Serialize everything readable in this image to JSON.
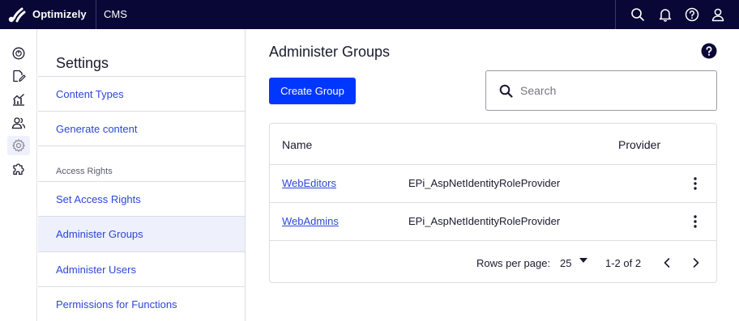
{
  "topbar": {
    "brand": "Optimizely",
    "product": "CMS",
    "icons": [
      "search-icon",
      "bell-icon",
      "help-icon",
      "user-icon"
    ],
    "background": "#080736"
  },
  "rail": {
    "items": [
      "dashboard-icon",
      "edit-icon",
      "analytics-icon",
      "users-icon",
      "gear-icon",
      "puzzle-icon"
    ],
    "active": "gear-icon"
  },
  "settings": {
    "title": "Settings",
    "items": [
      {
        "label": "Content Types"
      },
      {
        "label": "Generate content"
      },
      {
        "label": "Set Access Rights"
      },
      {
        "label": "Administer Groups"
      },
      {
        "label": "Administer Users"
      },
      {
        "label": "Permissions for Functions"
      }
    ],
    "section_header": "Access Rights",
    "active_item": "Administer Groups"
  },
  "main": {
    "title": "Administer Groups",
    "create_button": "Create Group",
    "search": {
      "placeholder": "Search",
      "value": ""
    },
    "table": {
      "headers": {
        "name": "Name",
        "provider": "Provider"
      },
      "rows": [
        {
          "name": "WebEditors",
          "provider": "EPi_AspNetIdentityRoleProvider"
        },
        {
          "name": "WebAdmins",
          "provider": "EPi_AspNetIdentityRoleProvider"
        }
      ],
      "footer": {
        "rows_per_page_label": "Rows per page:",
        "rows_per_page_value": "25",
        "range": "1-2 of 2"
      }
    }
  },
  "colors": {
    "accent": "#0037ff",
    "link": "#2c46d9",
    "active_bg": "#eef0fb"
  }
}
